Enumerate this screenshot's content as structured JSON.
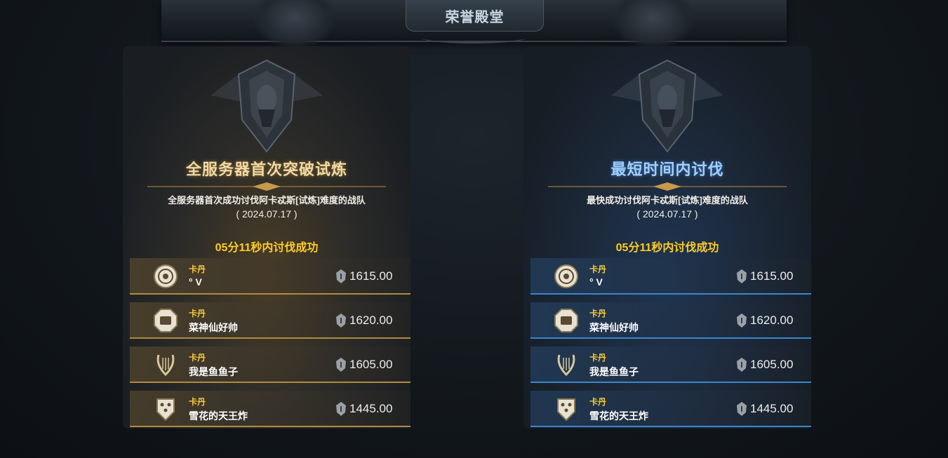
{
  "header": {
    "title": "荣誉殿堂"
  },
  "panels": [
    {
      "heading": "全服务器首次突破试炼",
      "description": "全服务器首次成功讨伐阿卡忒斯[试炼]难度的战队",
      "date": "( 2024.07.17 )",
      "result": "05分11秒内讨伐成功",
      "accent": "#b28a3e",
      "members": [
        {
          "guild": "卡丹",
          "name": "° V",
          "score": "1615.00",
          "badge_icon": "round-seal-badge-icon"
        },
        {
          "guild": "卡丹",
          "name": "菜神仙好帅",
          "score": "1620.00",
          "badge_icon": "octagon-fist-badge-icon"
        },
        {
          "guild": "卡丹",
          "name": "我是鱼鱼子",
          "score": "1605.00",
          "badge_icon": "lyre-badge-icon"
        },
        {
          "guild": "卡丹",
          "name": "雪花的天王炸",
          "score": "1445.00",
          "badge_icon": "dragon-shield-badge-icon"
        }
      ]
    },
    {
      "heading": "最短时间内讨伐",
      "description": "最快成功讨伐阿卡忒斯[试炼]难度的战队",
      "date": "( 2024.07.17 )",
      "result": "05分11秒内讨伐成功",
      "accent": "#3b86cf",
      "members": [
        {
          "guild": "卡丹",
          "name": "° V",
          "score": "1615.00",
          "badge_icon": "round-seal-badge-icon"
        },
        {
          "guild": "卡丹",
          "name": "菜神仙好帅",
          "score": "1620.00",
          "badge_icon": "octagon-fist-badge-icon"
        },
        {
          "guild": "卡丹",
          "name": "我是鱼鱼子",
          "score": "1605.00",
          "badge_icon": "lyre-badge-icon"
        },
        {
          "guild": "卡丹",
          "name": "雪花的天王炸",
          "score": "1445.00",
          "badge_icon": "dragon-shield-badge-icon"
        }
      ]
    }
  ],
  "icons": {
    "score_icon": "helmet-icon",
    "emblem_icon": "knight-shield-emblem-icon"
  }
}
